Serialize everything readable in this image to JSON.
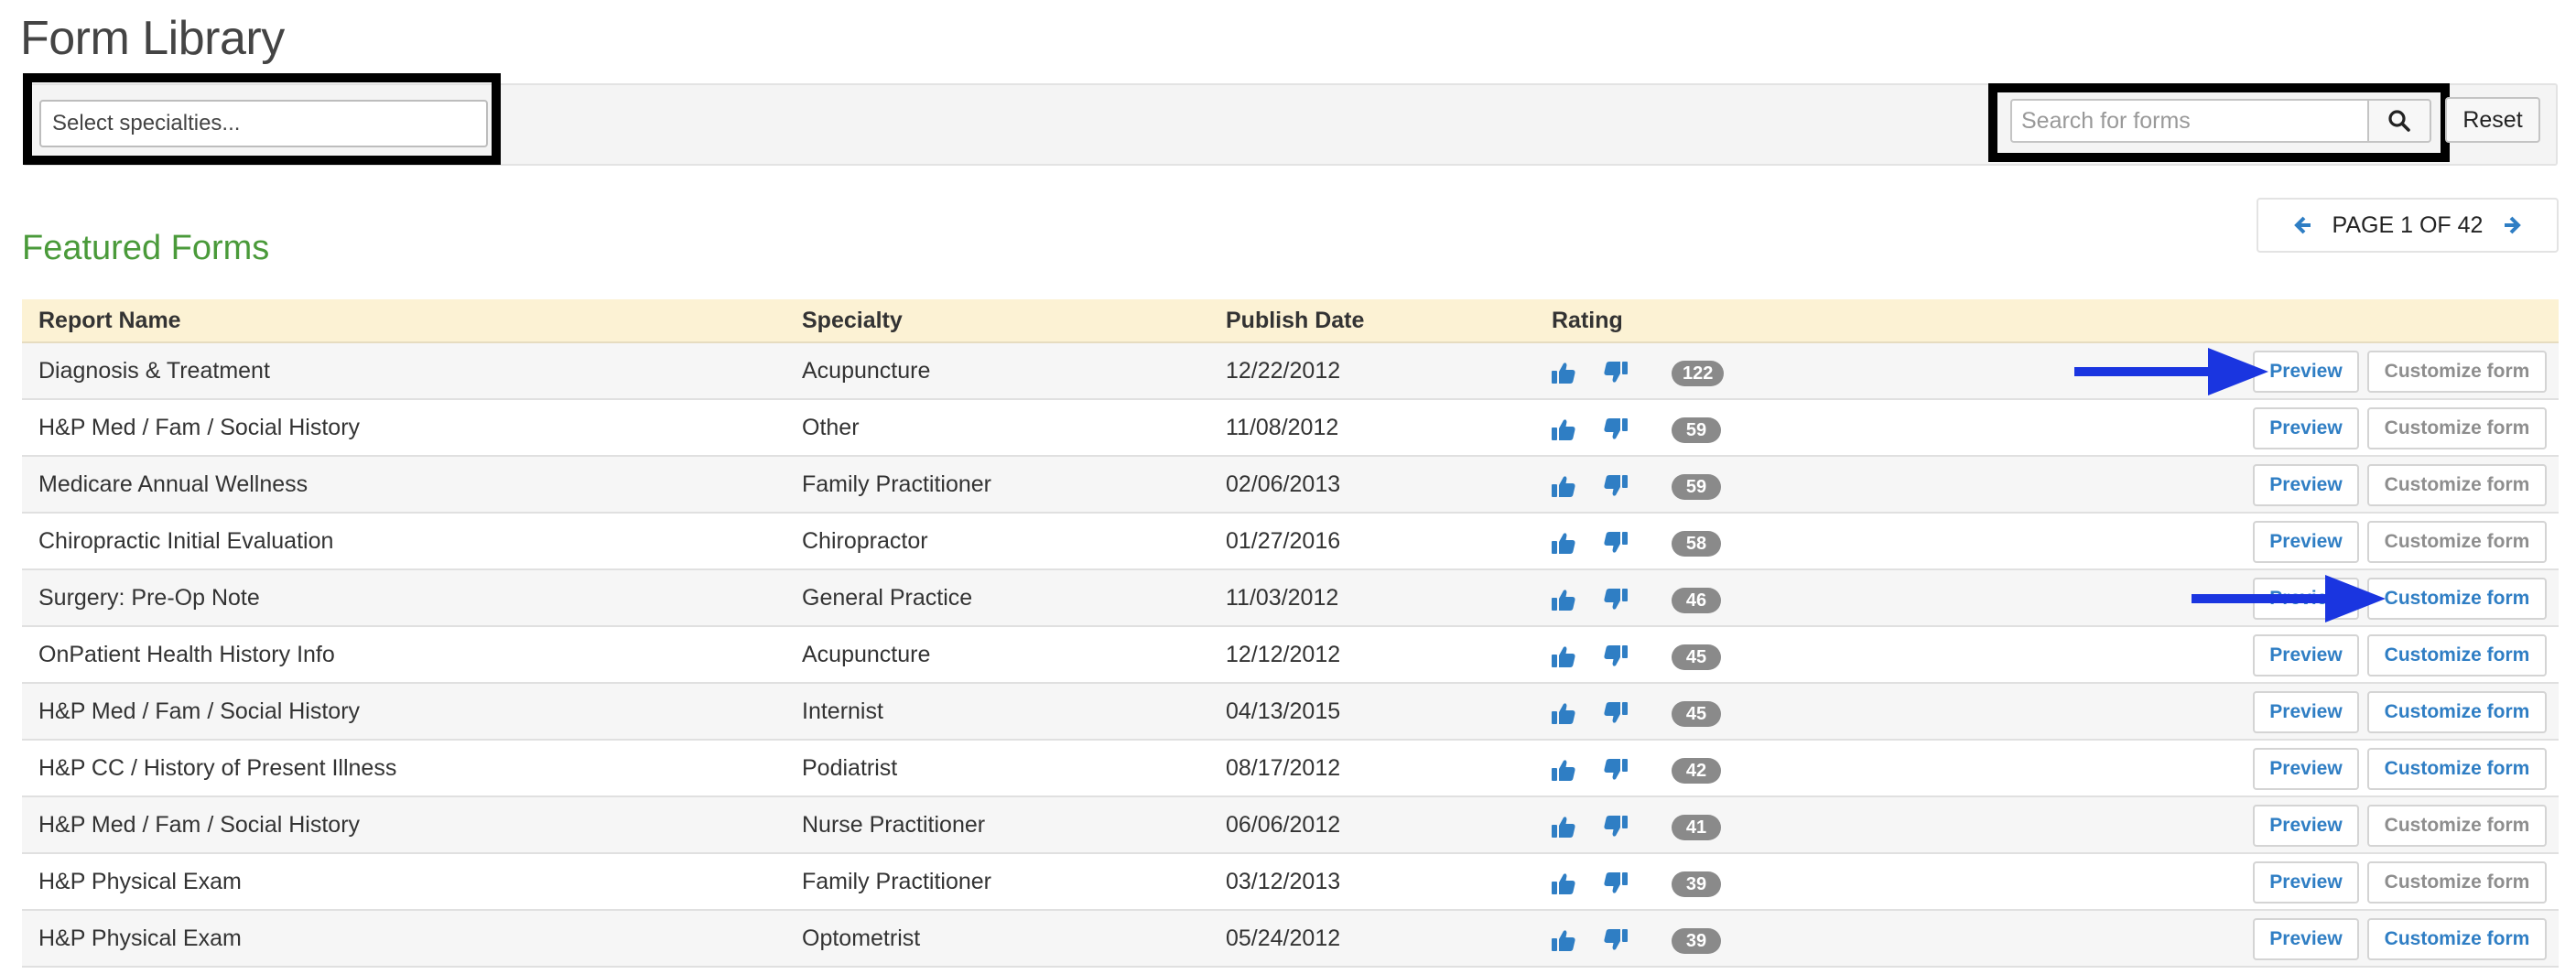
{
  "page": {
    "title": "Form Library"
  },
  "filters": {
    "specialty_placeholder": "Select specialties...",
    "search_placeholder": "Search for forms",
    "reset_label": "Reset"
  },
  "pagination": {
    "label": "PAGE 1 OF 42",
    "current": 1,
    "total": 42
  },
  "section": {
    "title": "Featured Forms"
  },
  "table": {
    "columns": [
      "Report Name",
      "Specialty",
      "Publish Date",
      "Rating"
    ],
    "preview_label": "Preview",
    "customize_label": "Customize form",
    "rows": [
      {
        "name": "Diagnosis & Treatment",
        "specialty": "Acupuncture",
        "date": "12/22/2012",
        "count": "122",
        "customize_enabled": false
      },
      {
        "name": "H&P Med / Fam / Social History",
        "specialty": "Other",
        "date": "11/08/2012",
        "count": "59",
        "customize_enabled": false
      },
      {
        "name": "Medicare Annual Wellness",
        "specialty": "Family Practitioner",
        "date": "02/06/2013",
        "count": "59",
        "customize_enabled": false
      },
      {
        "name": "Chiropractic Initial Evaluation",
        "specialty": "Chiropractor",
        "date": "01/27/2016",
        "count": "58",
        "customize_enabled": false
      },
      {
        "name": "Surgery: Pre-Op Note",
        "specialty": "General Practice",
        "date": "11/03/2012",
        "count": "46",
        "customize_enabled": true
      },
      {
        "name": "OnPatient Health History Info",
        "specialty": "Acupuncture",
        "date": "12/12/2012",
        "count": "45",
        "customize_enabled": true
      },
      {
        "name": "H&P Med / Fam / Social History",
        "specialty": "Internist",
        "date": "04/13/2015",
        "count": "45",
        "customize_enabled": true
      },
      {
        "name": "H&P CC / History of Present Illness",
        "specialty": "Podiatrist",
        "date": "08/17/2012",
        "count": "42",
        "customize_enabled": true
      },
      {
        "name": "H&P Med / Fam / Social History",
        "specialty": "Nurse Practitioner",
        "date": "06/06/2012",
        "count": "41",
        "customize_enabled": false
      },
      {
        "name": "H&P Physical Exam",
        "specialty": "Family Practitioner",
        "date": "03/12/2013",
        "count": "39",
        "customize_enabled": false
      },
      {
        "name": "H&P Physical Exam",
        "specialty": "Optometrist",
        "date": "05/24/2012",
        "count": "39",
        "customize_enabled": true
      }
    ]
  },
  "colors": {
    "accent_blue": "#2f7ec4",
    "section_green": "#4a9a3a",
    "header_bg": "#fcf2d4",
    "badge_gray": "#8a8a8a",
    "annotation_arrow": "#1a35e0"
  },
  "icons": [
    "search-icon",
    "chevron-left-icon",
    "chevron-right-icon",
    "thumbs-up-icon",
    "thumbs-down-icon"
  ]
}
